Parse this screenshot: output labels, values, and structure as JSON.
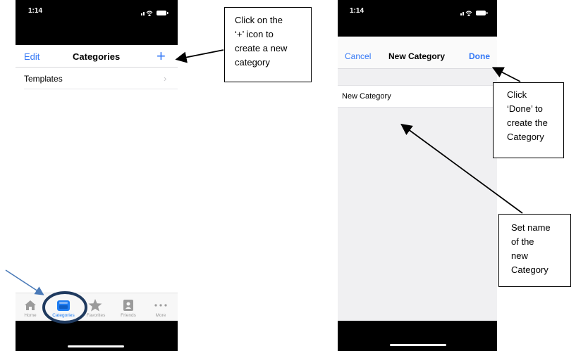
{
  "phone1": {
    "status": {
      "time": "1:14"
    },
    "nav": {
      "edit_label": "Edit",
      "title": "Categories",
      "add_icon": "plus-icon",
      "add_symbol": "+"
    },
    "list": [
      {
        "label": "Templates",
        "chevron": "›"
      }
    ],
    "tabs": [
      {
        "label": "Home",
        "icon": "home-icon"
      },
      {
        "label": "Categories",
        "icon": "tray-icon"
      },
      {
        "label": "Favorites",
        "icon": "star-icon"
      },
      {
        "label": "Friends",
        "icon": "person-badge-icon"
      },
      {
        "label": "More",
        "icon": "ellipsis-icon"
      }
    ]
  },
  "phone2": {
    "status": {
      "time": "1:14"
    },
    "nav": {
      "cancel_label": "Cancel",
      "title": "New Category",
      "done_label": "Done"
    },
    "field": {
      "value": "New Category"
    }
  },
  "callouts": {
    "plus": [
      "Click on the",
      "‘+’ icon to",
      "create a new",
      "category"
    ],
    "done": [
      "Click",
      "‘Done’ to",
      "create the",
      "Category"
    ],
    "name": [
      "Set name",
      "of the",
      "new",
      "Category"
    ]
  },
  "colors": {
    "ios_blue": "#3478f6",
    "annotation_arrow_blue": "#4a7ab8",
    "highlight_ring": "#1f3a5f",
    "tab_active": "#1d7cf2",
    "tab_inactive": "#9b9b9b"
  }
}
